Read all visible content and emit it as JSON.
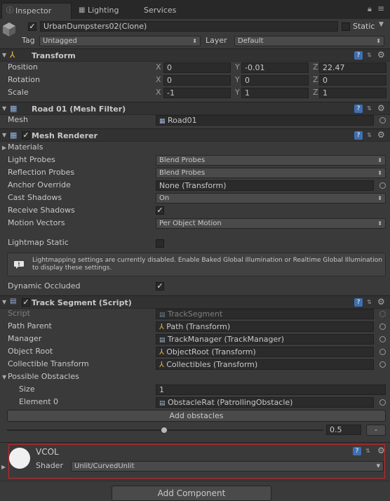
{
  "tabs": [
    {
      "label": "Inspector",
      "icon": "info-icon"
    },
    {
      "label": "Lighting",
      "icon": "lighting-icon"
    },
    {
      "label": "Services"
    }
  ],
  "object": {
    "name": "UrbanDumpsters02(Clone)",
    "active": true,
    "static_label": "Static",
    "tag_label": "Tag",
    "tag_value": "Untagged",
    "layer_label": "Layer",
    "layer_value": "Default"
  },
  "transform": {
    "title": "Transform",
    "position_label": "Position",
    "position": {
      "x": "0",
      "y": "-0.01",
      "z": "22.47"
    },
    "rotation_label": "Rotation",
    "rotation": {
      "x": "0",
      "y": "0",
      "z": "0"
    },
    "scale_label": "Scale",
    "scale": {
      "x": "-1",
      "y": "1",
      "z": "1"
    },
    "axis": {
      "x": "X",
      "y": "Y",
      "z": "Z"
    }
  },
  "mesh_filter": {
    "title": "Road 01 (Mesh Filter)",
    "mesh_label": "Mesh",
    "mesh_value": "Road01"
  },
  "mesh_renderer": {
    "title": "Mesh Renderer",
    "materials_label": "Materials",
    "light_probes_label": "Light Probes",
    "light_probes_value": "Blend Probes",
    "reflection_probes_label": "Reflection Probes",
    "reflection_probes_value": "Blend Probes",
    "anchor_override_label": "Anchor Override",
    "anchor_override_value": "None (Transform)",
    "cast_shadows_label": "Cast Shadows",
    "cast_shadows_value": "On",
    "receive_shadows_label": "Receive Shadows",
    "motion_vectors_label": "Motion Vectors",
    "motion_vectors_value": "Per Object Motion",
    "lightmap_static_label": "Lightmap Static",
    "info_message": "Lightmapping settings are currently disabled. Enable Baked Global Illumination or Realtime Global Illumination to display these settings.",
    "dynamic_occluded_label": "Dynamic Occluded"
  },
  "track_segment": {
    "title": "Track Segment (Script)",
    "script_label": "Script",
    "script_value": "TrackSegment",
    "path_parent_label": "Path Parent",
    "path_parent_value": "Path (Transform)",
    "manager_label": "Manager",
    "manager_value": "TrackManager (TrackManager)",
    "object_root_label": "Object Root",
    "object_root_value": "ObjectRoot (Transform)",
    "collectible_label": "Collectible Transform",
    "collectible_value": "Collectibles (Transform)",
    "possible_obstacles_label": "Possible Obstacles",
    "size_label": "Size",
    "size_value": "1",
    "element0_label": "Element 0",
    "element0_value": "ObstacleRat (PatrollingObstacle)",
    "add_obstacles_label": "Add obstacles",
    "slider_value": "0.5",
    "minus_label": "-"
  },
  "material": {
    "name": "VCOL",
    "shader_label": "Shader",
    "shader_value": "Unlit/CurvedUnlit"
  },
  "add_component_label": "Add Component",
  "colors": {
    "background": "#3a3a3a",
    "highlight_border": "#c8262a",
    "help_icon": "#3f6fb0"
  }
}
